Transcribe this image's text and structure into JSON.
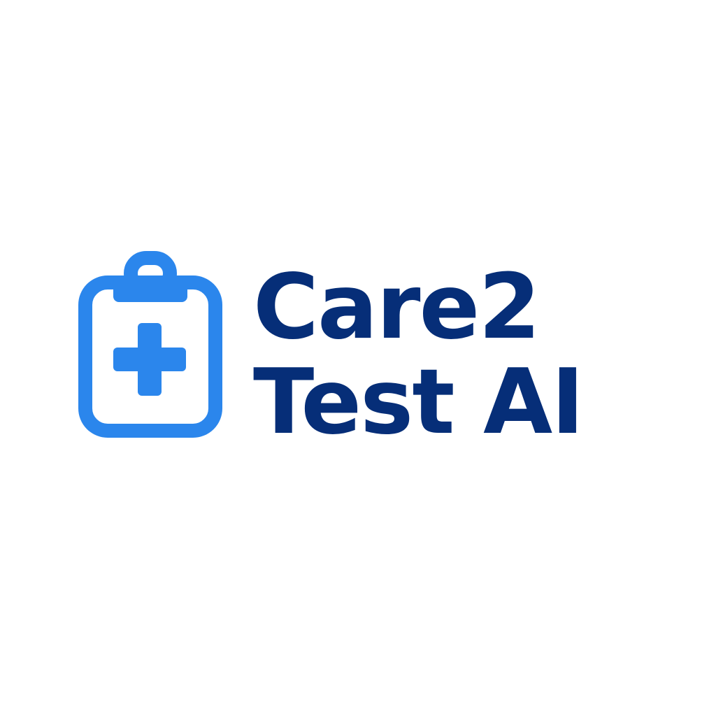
{
  "brand": {
    "line1": "Care2",
    "line2": "Test AI",
    "icon": "clipboard-medical-cross-icon"
  },
  "colors": {
    "icon": "#2b86ec",
    "text": "#062e78",
    "background": "#ffffff"
  }
}
